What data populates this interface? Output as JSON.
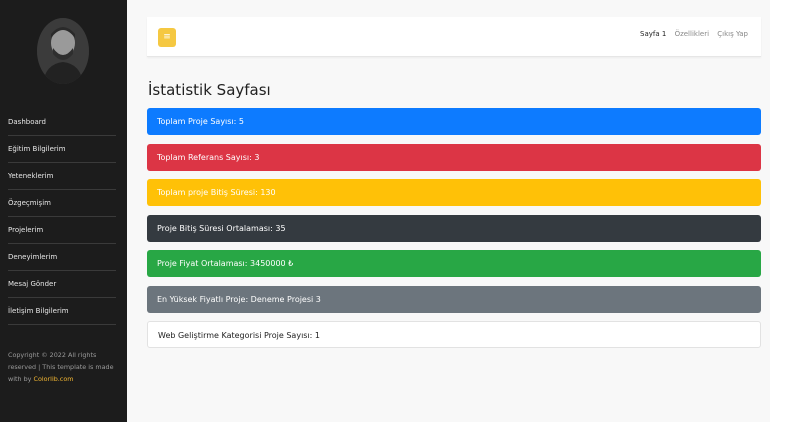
{
  "sidebar": {
    "items": [
      {
        "label": "Dashboard"
      },
      {
        "label": "Eğitim Bilgilerim"
      },
      {
        "label": "Yeteneklerim"
      },
      {
        "label": "Özgeçmişim"
      },
      {
        "label": "Projelerim"
      },
      {
        "label": "Deneyimlerim"
      },
      {
        "label": "Mesaj Gönder"
      },
      {
        "label": "İletişim Bilgilerim"
      }
    ],
    "footer": {
      "text": "Copyright © 2022 All rights reserved | This template is made with by",
      "link": "Colorlib.com"
    }
  },
  "topbar": {
    "toggle_icon": "≡",
    "links": [
      "Sayfa 1",
      "Özellikleri",
      "Çıkış Yap"
    ]
  },
  "page": {
    "title": "İstatistik Sayfası"
  },
  "stats": [
    {
      "label": "Toplam Proje Sayısı: 5",
      "color": "#0d7bff"
    },
    {
      "label": "Toplam Referans Sayısı: 3",
      "color": "#dc3545"
    },
    {
      "label": "Toplam proje Bitiş Süresi: 130",
      "color": "#ffc107"
    },
    {
      "label": "Proje Bitiş Süresi Ortalaması: 35",
      "color": "#343a40"
    },
    {
      "label": "Proje Fiyat Ortalaması: 3450000 ₺",
      "color": "#28a745"
    },
    {
      "label": "En Yüksek Fiyatlı Proje: Deneme Projesi 3",
      "color": "#6c757d"
    },
    {
      "label": "Web Geliştirme Kategorisi Proje Sayısı: 1",
      "color": "#ffffff"
    }
  ]
}
